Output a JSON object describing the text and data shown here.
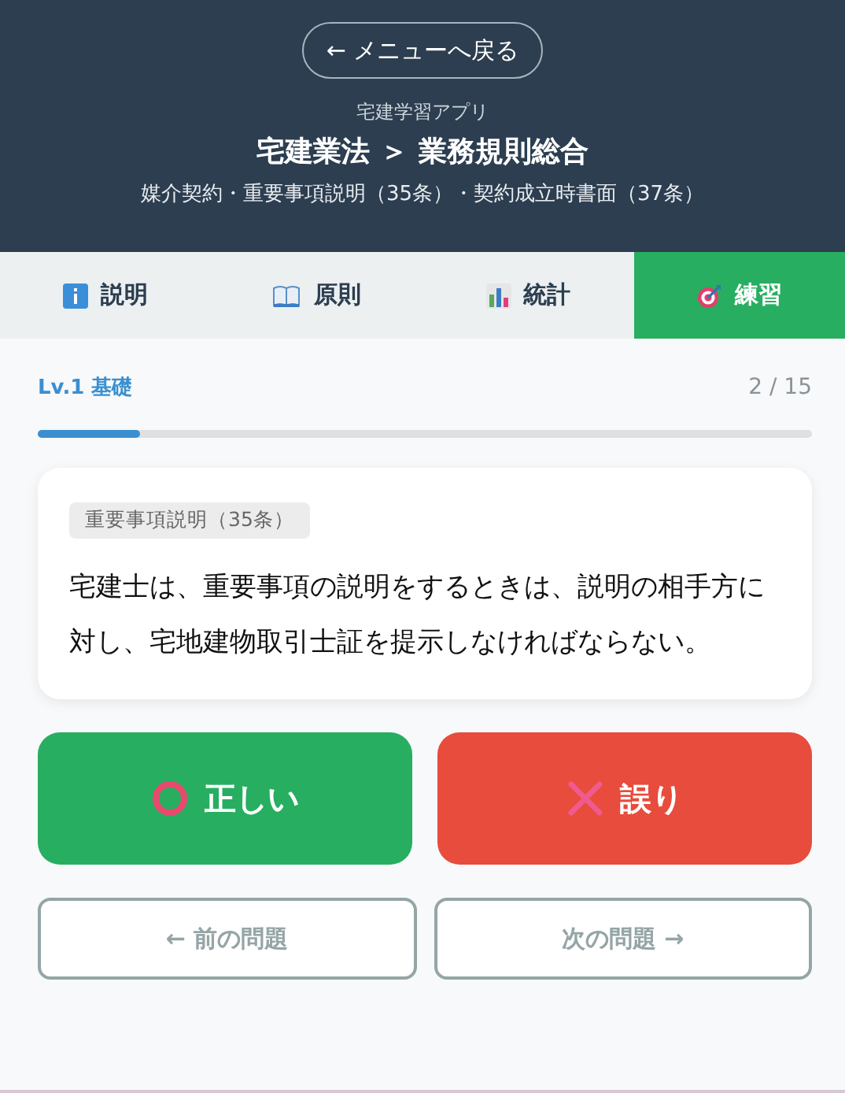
{
  "header": {
    "back_button": "← メニューへ戻る",
    "app_name": "宅建学習アプリ",
    "title": "宅建業法 ＞ 業務規則総合",
    "subtitle": "媒介契約・重要事項説明（35条）・契約成立時書面（37条）"
  },
  "tabs": [
    {
      "label": "説明",
      "kind": "info",
      "selected": false
    },
    {
      "label": "原則",
      "kind": "book",
      "selected": false
    },
    {
      "label": "統計",
      "kind": "chart",
      "selected": false
    },
    {
      "label": "練習",
      "kind": "target",
      "selected": true
    }
  ],
  "progress": {
    "level_label": "Lv.1 基礎",
    "count": "2 / 15",
    "level": 0.133
  },
  "question": {
    "tag": "重要事項説明（35条）",
    "text": "宅建士は、重要事項の説明をするときは、説明の相手方に対し、宅地建物取引士証を提示しなければならない。"
  },
  "answers": [
    {
      "label": "正しい",
      "kind": "correct"
    },
    {
      "label": "誤り",
      "kind": "wrong"
    }
  ],
  "navigation": [
    {
      "label": "← 前の問題"
    },
    {
      "label": "次の問題 →"
    }
  ]
}
